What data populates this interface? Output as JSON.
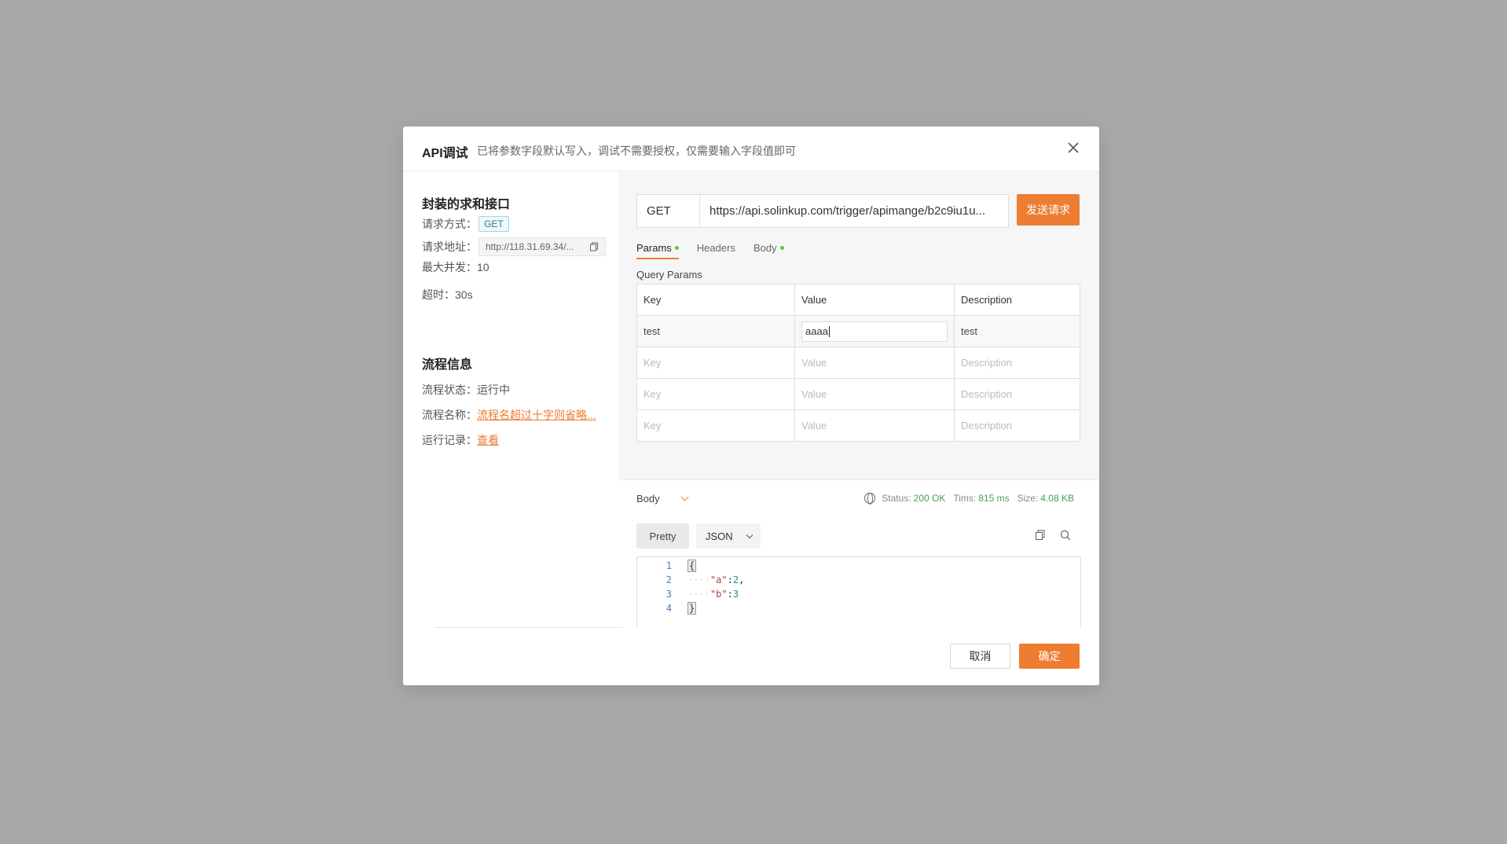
{
  "modal": {
    "title": "API调试",
    "subtitle": "已将参数字段默认写入，调试不需要授权，仅需要输入字段值即可"
  },
  "left": {
    "section1_title": "封装的求和接口",
    "method_label": "请求方式：",
    "method_value": "GET",
    "address_label": "请求地址：",
    "address_value": "http://118.31.69.34/...",
    "concurrency_label": "最大并发：",
    "concurrency_value": "10",
    "timeout_label": "超时：",
    "timeout_value": "30s",
    "section2_title": "流程信息",
    "status_label": "流程状态：",
    "status_value": "运行中",
    "name_label": "流程名称：",
    "name_value": "流程名超过十字则省略...",
    "record_label": "运行记录：",
    "record_value": "查看"
  },
  "request": {
    "method": "GET",
    "url": "https://api.solinkup.com/trigger/apimange/b2c9iu1u...",
    "send_label": "发送请求",
    "tabs": [
      {
        "label": "Params",
        "active": true,
        "dot": true
      },
      {
        "label": "Headers",
        "active": false,
        "dot": false
      },
      {
        "label": "Body",
        "active": false,
        "dot": true
      }
    ],
    "query_params_label": "Query Params",
    "columns": [
      "Key",
      "Value",
      "Description"
    ],
    "rows": [
      {
        "key": "test",
        "value": "aaaa",
        "description": "test"
      }
    ],
    "placeholder": {
      "key": "Key",
      "value": "Value",
      "description": "Description"
    }
  },
  "response": {
    "body_label": "Body",
    "status_label": "Status:",
    "status_value": "200 OK",
    "time_label": "Tims:",
    "time_value": "815 ms",
    "size_label": "Size:",
    "size_value": "4.08 KB",
    "pretty_label": "Pretty",
    "format_label": "JSON",
    "code_lines": [
      {
        "n": "1"
      },
      {
        "n": "2",
        "key": "\"a\"",
        "value": "2",
        "trail": ","
      },
      {
        "n": "3",
        "key": "\"b\"",
        "value": "3",
        "trail": ""
      },
      {
        "n": "4"
      }
    ]
  },
  "footer": {
    "cancel_label": "取消",
    "ok_label": "确定"
  },
  "colors": {
    "accent": "#ef7d31",
    "success": "#4aa05a",
    "overlay": "#a7a8aa"
  }
}
